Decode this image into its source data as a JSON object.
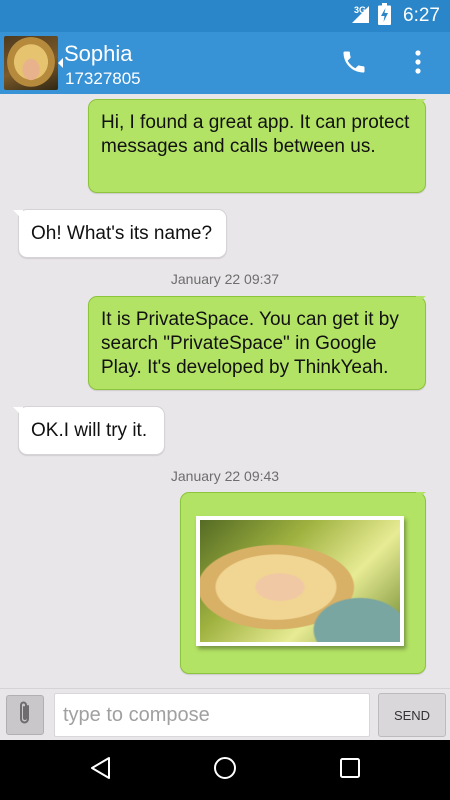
{
  "status_bar": {
    "network_type": "3G",
    "time": "6:27",
    "icons": [
      "signal-icon",
      "battery-charging-icon"
    ]
  },
  "header": {
    "contact_name": "Sophia",
    "contact_number": "17327805",
    "actions": [
      "call-icon",
      "overflow-menu-icon"
    ]
  },
  "messages": [
    {
      "direction": "outgoing",
      "text": "Hi, I found a great app. It can protect messages and calls between us."
    },
    {
      "direction": "incoming",
      "text": "Oh! What's its name?"
    },
    {
      "type": "timestamp",
      "text": "January 22 09:37"
    },
    {
      "direction": "outgoing",
      "text": "It is PrivateSpace. You can get it by search \"PrivateSpace\" in Google Play. It's developed by ThinkYeah."
    },
    {
      "direction": "incoming",
      "text": "OK.I will try it."
    },
    {
      "type": "timestamp",
      "text": "January 22 09:43"
    },
    {
      "direction": "outgoing",
      "type": "image",
      "icon": "photo-attachment"
    }
  ],
  "compose": {
    "placeholder": "type to compose",
    "value": "",
    "send_label": "SEND",
    "attach_icon": "paperclip-icon"
  },
  "nav_bar": {
    "icons": [
      "back-icon",
      "home-icon",
      "recents-icon"
    ]
  },
  "colors": {
    "status_bar": "#2a86c8",
    "app_bar": "#3792d6",
    "outgoing_bubble": "#b3e364",
    "incoming_bubble": "#ffffff",
    "background": "#e9e6e9"
  }
}
